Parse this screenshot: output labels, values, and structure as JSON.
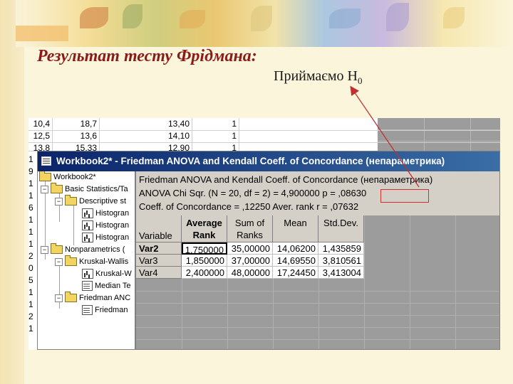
{
  "slide": {
    "title": "Результат тесту Фрідмана:",
    "annotation": "Приймаємо H",
    "annotation_sub": "0"
  },
  "background_sheet": {
    "rows": [
      [
        "10,4",
        "18,7",
        "13,40",
        "1"
      ],
      [
        "12,5",
        "13,6",
        "14,10",
        "1"
      ],
      [
        "13,8",
        "15,33",
        "12,90",
        "1"
      ]
    ],
    "row_fragments": [
      "1",
      "9",
      "1",
      "1",
      "6",
      "1",
      "1",
      "1",
      "2",
      "0",
      "5",
      "1",
      "1",
      "2",
      "1"
    ]
  },
  "workbook": {
    "title": "Workbook2* - Friedman ANOVA and Kendall Coeff. of Concordance (непараметрика)",
    "tree": [
      {
        "label": "Workbook2*",
        "kind": "folder",
        "expander": ""
      },
      {
        "label": "Basic Statistics/Ta",
        "kind": "folder",
        "expander": "−"
      },
      {
        "label": "Descriptive st",
        "kind": "folder",
        "expander": "−"
      },
      {
        "label": "Histogran",
        "kind": "hist",
        "expander": ""
      },
      {
        "label": "Histogran",
        "kind": "hist",
        "expander": ""
      },
      {
        "label": "Histogran",
        "kind": "hist",
        "expander": ""
      },
      {
        "label": "Nonparametrics (",
        "kind": "folder",
        "expander": "−"
      },
      {
        "label": "Kruskal-Wallis",
        "kind": "folder",
        "expander": "−"
      },
      {
        "label": "Kruskal-W",
        "kind": "hist",
        "expander": ""
      },
      {
        "label": "Median Te",
        "kind": "sheet",
        "expander": ""
      },
      {
        "label": "Friedman ANC",
        "kind": "folder",
        "expander": "−"
      },
      {
        "label": "Friedman",
        "kind": "sheet",
        "expander": ""
      }
    ],
    "header_lines": [
      "Friedman ANOVA and Kendall Coeff. of Concordance (непараметрика)",
      "ANOVA Chi Sqr. (N = 20, df = 2) = 4,900000  p = ,08630",
      "Coeff. of Concordance = ,12250 Aver. rank r = ,07632"
    ],
    "row_header_title": "Variable",
    "columns": [
      "Average Rank",
      "Sum of Ranks",
      "Mean",
      "Std.Dev."
    ],
    "rows": [
      {
        "name": "Var2",
        "values": [
          "1,750000",
          "35,00000",
          "14,06200",
          "1,435859"
        ]
      },
      {
        "name": "Var3",
        "values": [
          "1,850000",
          "37,00000",
          "14,69550",
          "3,810561"
        ]
      },
      {
        "name": "Var4",
        "values": [
          "2,400000",
          "48,00000",
          "17,24450",
          "3,413004"
        ]
      }
    ]
  },
  "colors": {
    "title": "#8b1a1a",
    "highlight_box": "#d03030",
    "arrow": "#c03030",
    "titlebar_start": "#0a246a",
    "titlebar_end": "#3a6ea5"
  }
}
